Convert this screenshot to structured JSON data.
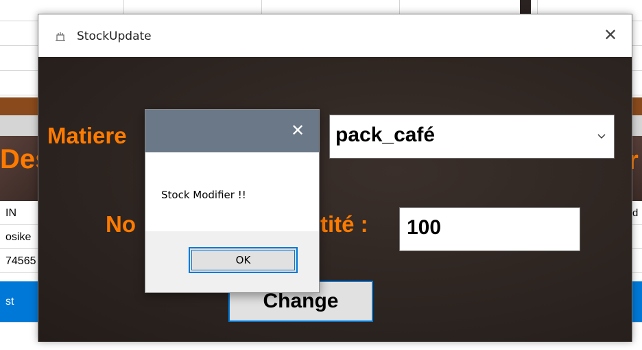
{
  "background": {
    "heading_left": "Des",
    "heading_right": "r",
    "rows": [
      {
        "text": "IN",
        "right": "d",
        "selected": false
      },
      {
        "text": "osike",
        "right": "",
        "selected": false
      },
      {
        "text": "74565",
        "right": "",
        "selected": false
      },
      {
        "text": "st",
        "right": "",
        "selected": true
      }
    ]
  },
  "window": {
    "title": "StockUpdate",
    "app_icon": "app-icon",
    "close_glyph": "✕",
    "matiere_label": "Matiere",
    "quantite_label_left": "No",
    "quantite_label_right": "tité :",
    "select_value": "pack_café",
    "select_chevron": "⌵",
    "quantity_value": "100",
    "change_label": "Change"
  },
  "dialog": {
    "close_glyph": "✕",
    "message": "Stock Modifier !!",
    "ok_label": "OK"
  },
  "colors": {
    "accent_orange": "#ff7b00",
    "window_bg": "#2d2522",
    "dialog_titlebar": "#6a7887",
    "focus_blue": "#0078d7"
  }
}
